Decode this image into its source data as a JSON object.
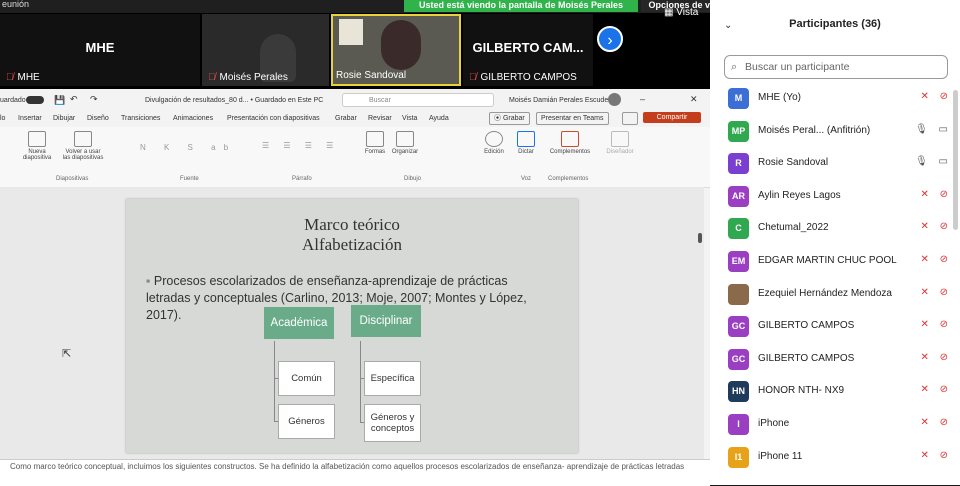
{
  "topbar": {
    "app_title": "eunión",
    "share_banner": "Usted está viendo la pantalla de Moisés Perales",
    "view_options": "Opciones de vista",
    "vista": "Vista"
  },
  "videos": [
    {
      "big": "MHE",
      "label": "MHE"
    },
    {
      "big": "",
      "label": "Moisés Perales"
    },
    {
      "big": "",
      "label": "Rosie Sandoval"
    },
    {
      "big": "GILBERTO  CAM...",
      "label": "GILBERTO CAMPOS"
    }
  ],
  "ppt": {
    "autosave": "uardado",
    "doc_name": "Divulgación de resultados_80 d... • Guardado en Este PC",
    "search_placeholder": "Buscar",
    "user": "Moisés Damián Perales Escudero",
    "menu": [
      "lo",
      "Insertar",
      "Dibujar",
      "Diseño",
      "Transiciones",
      "Animaciones",
      "Presentación con diapositivas",
      "Grabar",
      "Revisar",
      "Vista",
      "Ayuda"
    ],
    "grabar_btn": "Grabar",
    "teams_btn": "Presentar en Teams",
    "share_btn": "Compartir",
    "ribbon": {
      "nueva": "Nueva diapositiva",
      "volver": "Volver a usar las diapositivas",
      "formas": "Formas",
      "organizar": "Organizar",
      "edicion": "Edición",
      "dictar": "Dictar",
      "complementos": "Complementos",
      "disenador": "Diseñador",
      "groups": [
        "Diapositivas",
        "Fuente",
        "Párrafo",
        "Dibujo",
        "Voz",
        "Complementos"
      ]
    },
    "notes": "Como marco teórico conceptual, incluimos los siguientes constructos. Se ha definido la alfabetización como aquellos procesos escolarizados de enseñanza- aprendizaje de prácticas letradas"
  },
  "slide": {
    "title_line1": "Marco teórico",
    "title_line2": "Alfabetización",
    "bullet": "Procesos escolarizados de enseñanza-aprendizaje de prácticas letradas y conceptuales (Carlino, 2013; Moje, 2007; Montes y López, 2017).",
    "academica": "Académica",
    "disciplinar": "Disciplinar",
    "comun": "Común",
    "generos": "Géneros",
    "especifica": "Específica",
    "generos_conceptos": "Géneros y conceptos"
  },
  "panel": {
    "title": "Participantes (36)",
    "search_placeholder": "Buscar un participante",
    "participants": [
      {
        "initials": "M",
        "name": "MHE (Yo)",
        "color": "#3b6fd6"
      },
      {
        "initials": "MP",
        "name": "Moisés Peral... (Anfitrión)",
        "color": "#2fa84f"
      },
      {
        "initials": "R",
        "name": "Rosie Sandoval",
        "color": "#7a3fd0"
      },
      {
        "initials": "AR",
        "name": "Aylin Reyes Lagos",
        "color": "#9a3fc2"
      },
      {
        "initials": "C",
        "name": "Chetumal_2022",
        "color": "#2fa84f"
      },
      {
        "initials": "EM",
        "name": "EDGAR MARTIN CHUC POOL",
        "color": "#9a3fc2"
      },
      {
        "initials": "",
        "name": "Ezequiel Hernández Mendoza",
        "color": "#8a6a4a"
      },
      {
        "initials": "GC",
        "name": "GILBERTO CAMPOS",
        "color": "#9a3fc2"
      },
      {
        "initials": "GC",
        "name": "GILBERTO CAMPOS",
        "color": "#9a3fc2"
      },
      {
        "initials": "HN",
        "name": "HONOR NTH- NX9",
        "color": "#1f3a5a"
      },
      {
        "initials": "I",
        "name": "iPhone",
        "color": "#9a3fc2"
      },
      {
        "initials": "I1",
        "name": "iPhone 11",
        "color": "#e8a21a"
      }
    ]
  }
}
